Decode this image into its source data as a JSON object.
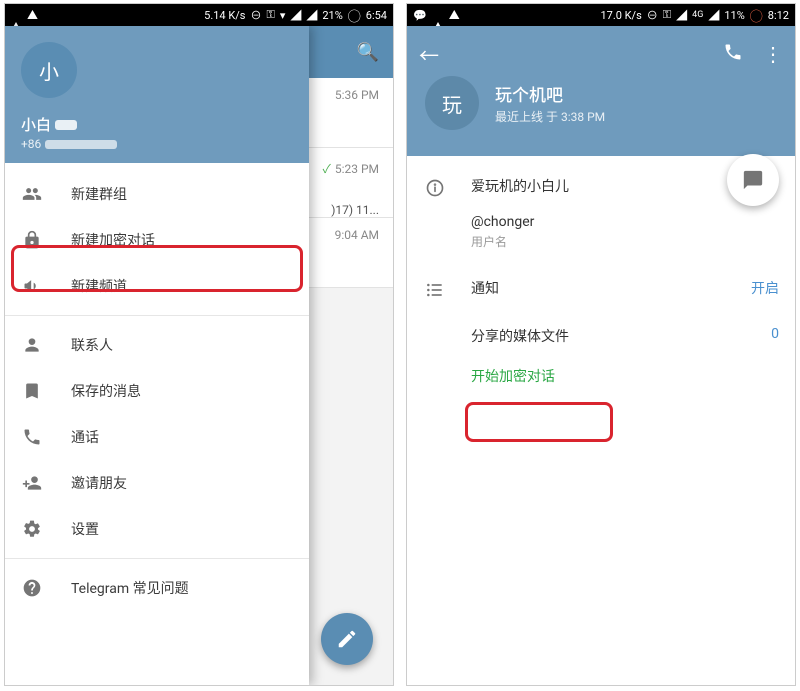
{
  "left": {
    "status": {
      "speed": "5.14 K/s",
      "battery": "21%",
      "clock": "6:54"
    },
    "bg": {
      "chat1_time": "5:36 PM",
      "chat2_time": "5:23 PM",
      "chat2_sub": ")17) 11...",
      "chat3_time": "9:04 AM"
    },
    "drawer": {
      "avatar_letter": "小",
      "username_prefix": "小白",
      "phone_prefix": "+86",
      "items": {
        "new_group": "新建群组",
        "new_secret_chat": "新建加密对话",
        "new_channel": "新建频道",
        "contacts": "联系人",
        "saved_messages": "保存的消息",
        "calls": "通话",
        "invite_friends": "邀请朋友",
        "settings": "设置",
        "telegram_faq": "Telegram 常见问题"
      }
    }
  },
  "right": {
    "status": {
      "speed": "17.0 K/s",
      "net": "4G",
      "battery": "11%",
      "clock": "8:12"
    },
    "profile": {
      "avatar_letter": "玩",
      "name": "玩个机吧",
      "last_seen": "最近上线 于 3:38 PM",
      "info_title": "爱玩机的小白儿",
      "handle": "@chonger",
      "handle_label": "用户名",
      "notifications_label": "通知",
      "notifications_value": "开启",
      "shared_media_label": "分享的媒体文件",
      "shared_media_value": "0",
      "start_secret_chat": "开始加密对话"
    }
  }
}
